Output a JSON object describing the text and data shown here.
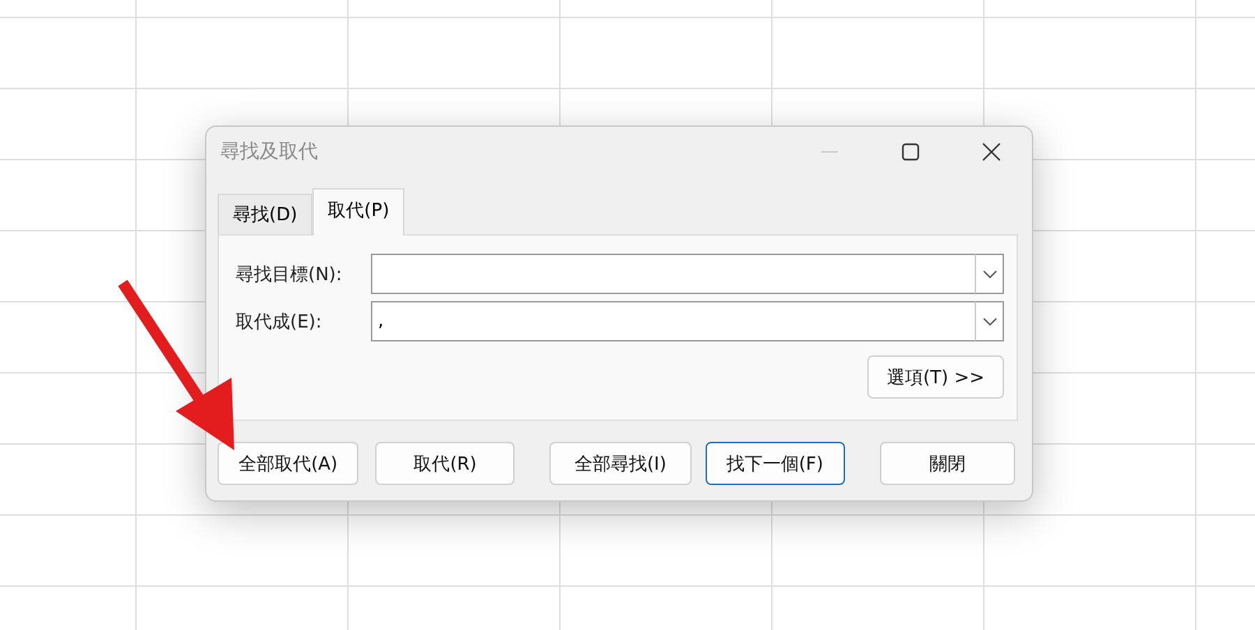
{
  "window": {
    "title": "尋找及取代"
  },
  "tabs": [
    {
      "label": "尋找(D)",
      "selected": false
    },
    {
      "label": "取代(P)",
      "selected": true
    }
  ],
  "fields": [
    {
      "label": "尋找目標(N):"
    },
    {
      "label": "取代成(E):",
      "value": ","
    }
  ],
  "options_button": "選項(T) >>",
  "buttons": [
    {
      "label": "全部取代(A)",
      "default": false
    },
    {
      "label": "取代(R)",
      "default": false
    },
    {
      "label": "全部尋找(I)",
      "default": false
    },
    {
      "label": "找下一個(F)",
      "default": true
    },
    {
      "label": "關閉",
      "default": false
    }
  ]
}
